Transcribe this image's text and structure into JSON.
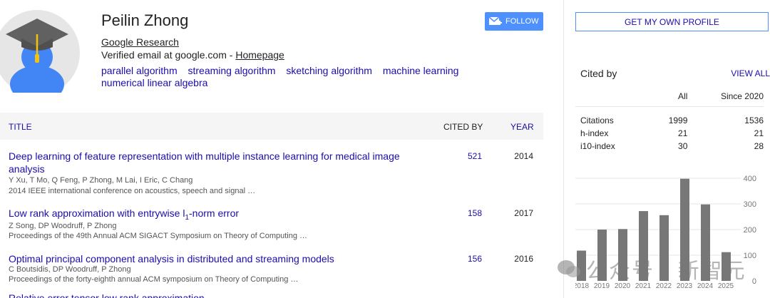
{
  "profile": {
    "name": "Peilin Zhong",
    "affiliation": "Google Research",
    "verified_text": "Verified email at google.com - ",
    "homepage_label": "Homepage",
    "interests": [
      "parallel algorithm",
      "streaming algorithm",
      "sketching algorithm",
      "machine learning",
      "numerical linear algebra"
    ],
    "follow_label": "FOLLOW"
  },
  "sidebar": {
    "get_profile_label": "GET MY OWN PROFILE",
    "cited_by_label": "Cited by",
    "view_all_label": "VIEW ALL",
    "columns": [
      "All",
      "Since 2020"
    ],
    "rows": [
      {
        "label": "Citations",
        "all": "1999",
        "since": "1536"
      },
      {
        "label": "h-index",
        "all": "21",
        "since": "21"
      },
      {
        "label": "i10-index",
        "all": "30",
        "since": "28"
      }
    ]
  },
  "table": {
    "title_header": "TITLE",
    "cited_by_header": "CITED BY",
    "year_header": "YEAR",
    "papers": [
      {
        "title": "Deep learning of feature representation with multiple instance learning for medical image analysis",
        "authors": "Y Xu, T Mo, Q Feng, P Zhong, M Lai, I Eric, C Chang",
        "venue": "2014 IEEE international conference on acoustics, speech and signal …",
        "cited_by": "521",
        "year": "2014"
      },
      {
        "title_prefix": "Low rank approximation with entrywise l",
        "title_sub": "1",
        "title_suffix": "-norm error",
        "authors": "Z Song, DP Woodruff, P Zhong",
        "venue": "Proceedings of the 49th Annual ACM SIGACT Symposium on Theory of Computing …",
        "cited_by": "158",
        "year": "2017"
      },
      {
        "title": "Optimal principal component analysis in distributed and streaming models",
        "authors": "C Boutsidis, DP Woodruff, P Zhong",
        "venue": "Proceedings of the forty-eighth annual ACM symposium on Theory of Computing …",
        "cited_by": "156",
        "year": "2016"
      }
    ],
    "partial_title": "Relative error tensor low rank approximation"
  },
  "chart_data": {
    "type": "bar",
    "categories": [
      "2018",
      "2019",
      "2020",
      "2021",
      "2022",
      "2023",
      "2024",
      "2025"
    ],
    "values": [
      118,
      200,
      202,
      272,
      256,
      398,
      298,
      112
    ],
    "ylim": [
      0,
      400
    ],
    "yticks": [
      "0",
      "100",
      "200",
      "300",
      "400"
    ],
    "grid": true,
    "color": "#777777"
  },
  "watermark": {
    "text": "公众号 · 新智元"
  }
}
